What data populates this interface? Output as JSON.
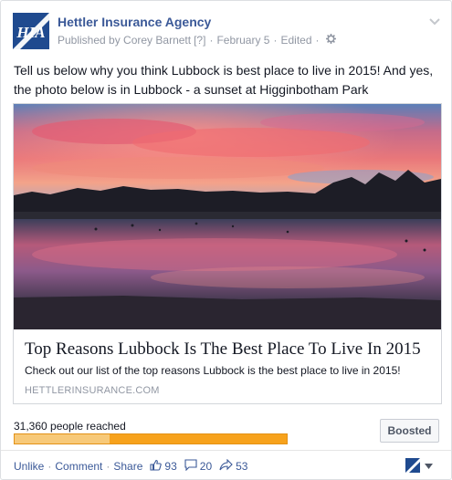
{
  "post": {
    "page_name": "Hettler Insurance Agency",
    "published_by": "Published by Corey Barnett",
    "help_marker": "[?]",
    "date": "February 5",
    "edited": "Edited",
    "text": "Tell us below why you think Lubbock is best place to live in 2015! And yes, the photo below is in Lubbock - a sunset at Higginbotham Park"
  },
  "avatar": {
    "logo_text": "HIA"
  },
  "link_preview": {
    "title": "Top Reasons Lubbock Is The Best Place To Live In 2015",
    "description": "Check out our list of the top reasons Lubbock is the best place to live in 2015!",
    "domain": "HETTLERINSURANCE.COM"
  },
  "reach": {
    "label": "31,360 people reached",
    "organic_fraction": 0.35,
    "boosted_label": "Boosted"
  },
  "footer": {
    "unlike": "Unlike",
    "comment": "Comment",
    "share": "Share",
    "likes": "93",
    "comments": "20",
    "shares": "53"
  },
  "colors": {
    "link": "#3b5998",
    "reach_paid": "#f7a21c",
    "reach_organic": "#f7c979",
    "logo_bg": "#1f4a8f"
  },
  "icons": [
    "gear-icon",
    "chevron-down-icon",
    "like-icon",
    "comment-icon",
    "share-icon",
    "page-logo-icon",
    "dropdown-caret-icon"
  ]
}
